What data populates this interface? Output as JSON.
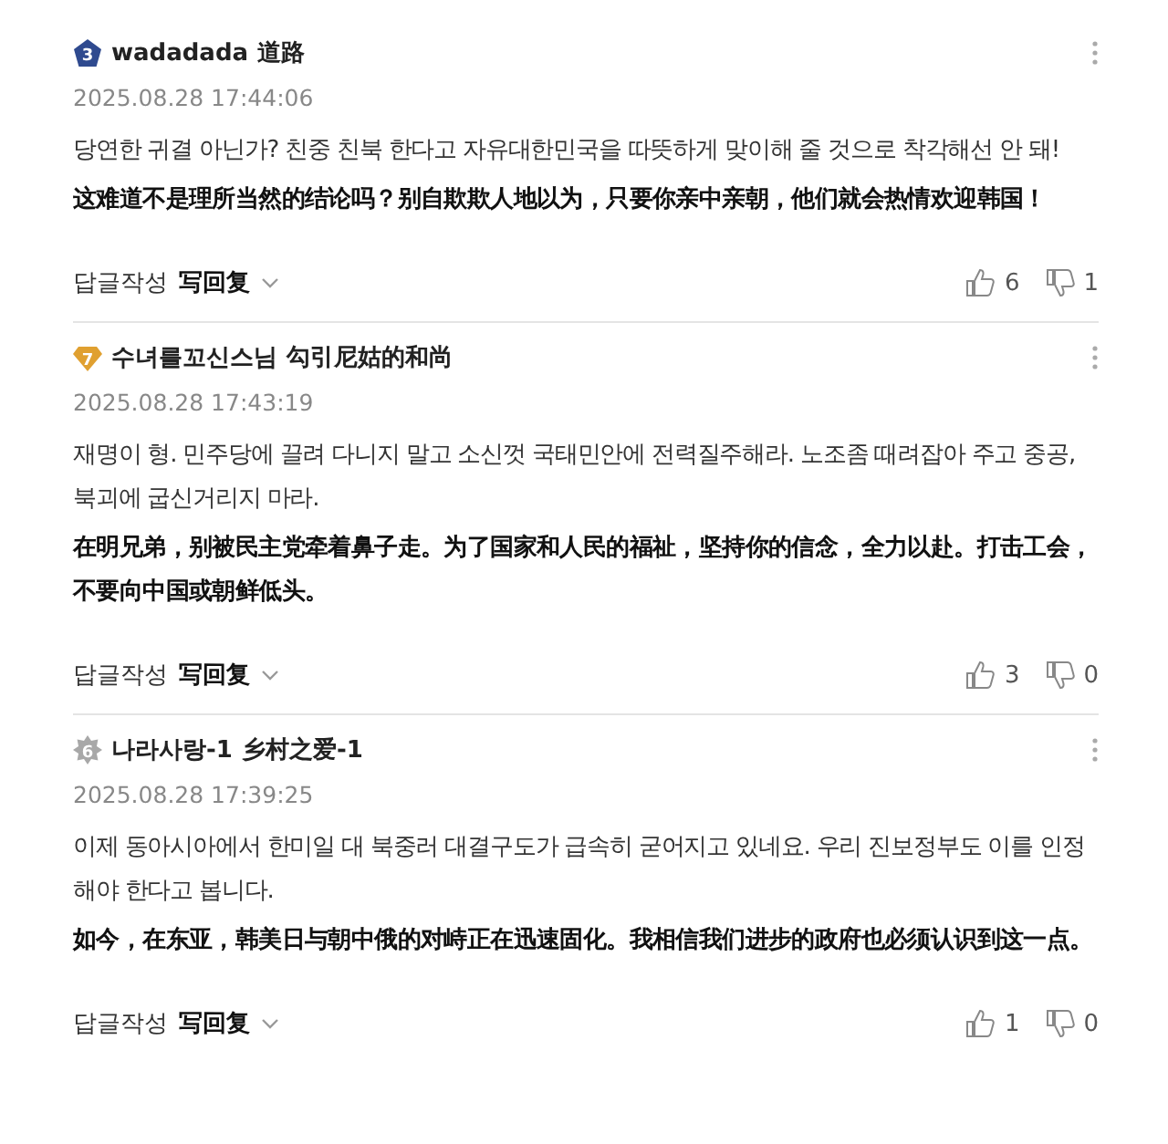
{
  "comments": [
    {
      "badge": {
        "kind": "pentagon",
        "number": "3",
        "color": "#2f4a8f"
      },
      "author": "wadadada",
      "author_translation": "道路",
      "date": "2025.08.28 17:44:06",
      "text": "당연한 귀결 아닌가? 친중 친북 한다고 자유대한민국을 따뜻하게 맞이해 줄 것으로 착각해선 안 돼!",
      "translation": "这难道不是理所当然的结论吗？别自欺欺人地以为，只要你亲中亲朝，他们就会热情欢迎韩国！",
      "reply_label": "답글작성",
      "reply_translation": "写回复",
      "likes": "6",
      "dislikes": "1"
    },
    {
      "badge": {
        "kind": "diamond",
        "number": "7",
        "color": "#e0a030"
      },
      "author": "수녀를꼬신스님",
      "author_translation": "勾引尼姑的和尚",
      "date": "2025.08.28 17:43:19",
      "text": "재명이 형. 민주당에 끌려 다니지 말고 소신껏 국태민안에 전력질주해라. 노조좀 때려잡아 주고 중공, 북괴에 굽신거리지 마라.",
      "translation": "在明兄弟，别被民主党牵着鼻子走。为了国家和人民的福祉，坚持你的信念，全力以赴。打击工会，不要向中国或朝鲜低头。",
      "reply_label": "답글작성",
      "reply_translation": "写回复",
      "likes": "3",
      "dislikes": "0"
    },
    {
      "badge": {
        "kind": "gear",
        "number": "6",
        "color": "#a8a8a8"
      },
      "author": "나라사랑-1",
      "author_translation": "乡村之爱-1",
      "date": "2025.08.28 17:39:25",
      "text": "이제 동아시아에서 한미일 대 북중러 대결구도가 급속히 굳어지고 있네요. 우리 진보정부도 이를 인정해야 한다고 봅니다.",
      "translation": "如今，在东亚，韩美日与朝中俄的对峙正在迅速固化。我相信我们进步的政府也必须认识到这一点。",
      "reply_label": "답글작성",
      "reply_translation": "写回复",
      "likes": "1",
      "dislikes": "0"
    }
  ]
}
